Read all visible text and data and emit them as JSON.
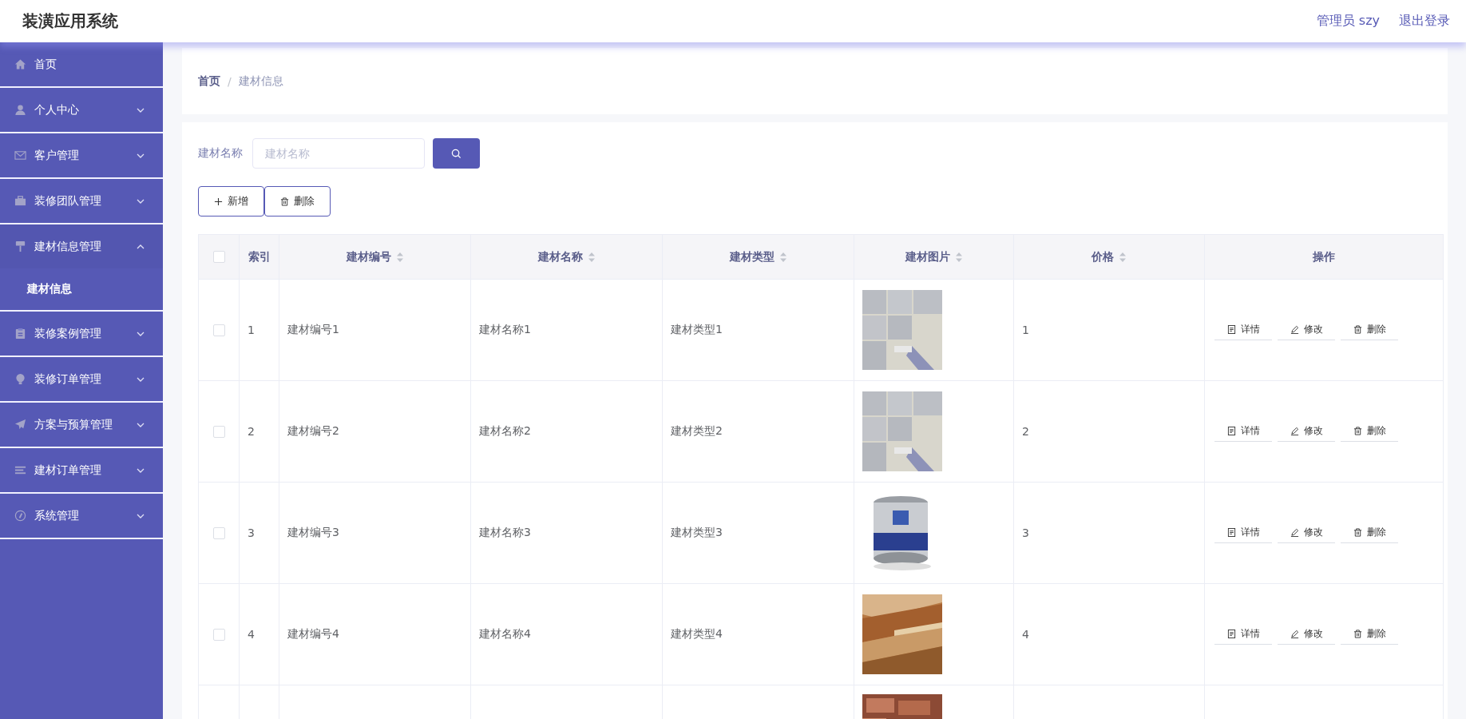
{
  "app_title": "装潢应用系统",
  "header_links": [
    {
      "label": "管理员 szy"
    },
    {
      "label": "退出登录"
    }
  ],
  "sidebar": {
    "items": [
      {
        "label": "首页",
        "kind": "link"
      },
      {
        "label": "个人中心",
        "kind": "submenu",
        "expanded": false
      },
      {
        "label": "客户管理",
        "kind": "submenu",
        "expanded": false
      },
      {
        "label": "装修团队管理",
        "kind": "submenu",
        "expanded": false
      },
      {
        "label": "建材信息管理",
        "kind": "submenu",
        "expanded": true,
        "children": [
          {
            "label": "建材信息",
            "selected": true
          }
        ]
      },
      {
        "label": "装修案例管理",
        "kind": "submenu",
        "expanded": false
      },
      {
        "label": "装修订单管理",
        "kind": "submenu",
        "expanded": false
      },
      {
        "label": "方案与预算管理",
        "kind": "submenu",
        "expanded": false
      },
      {
        "label": "建材订单管理",
        "kind": "submenu",
        "expanded": false
      },
      {
        "label": "系统管理",
        "kind": "submenu",
        "expanded": false
      }
    ]
  },
  "breadcrumb": [
    {
      "label": "首页"
    },
    {
      "separator": "/",
      "label": "建材信息"
    }
  ],
  "search": {
    "label": "建材名称",
    "placeholder": "建材名称"
  },
  "toolbar": [
    {
      "label": "新增",
      "kind": "add"
    },
    {
      "label": "删除",
      "kind": "delete"
    }
  ],
  "table": {
    "all_checked": false,
    "columns": [
      {
        "label": "索引",
        "sortable": false
      },
      {
        "label": "建材编号",
        "sortable": true
      },
      {
        "label": "建材名称",
        "sortable": true
      },
      {
        "label": "建材类型",
        "sortable": true
      },
      {
        "label": "建材图片",
        "sortable": true
      },
      {
        "label": "价格",
        "sortable": true
      },
      {
        "label": "操作",
        "sortable": false
      }
    ],
    "rows": [
      {
        "checked": false,
        "index": "1",
        "code": "建材编号1",
        "name": "建材名称1",
        "type": "建材类型1",
        "image": {
          "kind": "picture"
        },
        "price": "1",
        "actions": [
          {
            "label": "详情",
            "kind": "detail"
          },
          {
            "label": "修改",
            "kind": "edit"
          },
          {
            "label": "删除",
            "kind": "delete"
          }
        ]
      },
      {
        "checked": false,
        "index": "2",
        "code": "建材编号2",
        "name": "建材名称2",
        "type": "建材类型2",
        "image": {
          "kind": "picture"
        },
        "price": "2",
        "actions": [
          {
            "label": "详情",
            "kind": "detail"
          },
          {
            "label": "修改",
            "kind": "edit"
          },
          {
            "label": "删除",
            "kind": "delete"
          }
        ]
      },
      {
        "checked": false,
        "index": "3",
        "code": "建材编号3",
        "name": "建材名称3",
        "type": "建材类型3",
        "image": {
          "kind": "picture"
        },
        "price": "3",
        "actions": [
          {
            "label": "详情",
            "kind": "detail"
          },
          {
            "label": "修改",
            "kind": "edit"
          },
          {
            "label": "删除",
            "kind": "delete"
          }
        ]
      },
      {
        "checked": false,
        "index": "4",
        "code": "建材编号4",
        "name": "建材名称4",
        "type": "建材类型4",
        "image": {
          "kind": "picture"
        },
        "price": "4",
        "actions": [
          {
            "label": "详情",
            "kind": "detail"
          },
          {
            "label": "修改",
            "kind": "edit"
          },
          {
            "label": "删除",
            "kind": "delete"
          }
        ]
      },
      {
        "image": {
          "kind": "picture"
        }
      }
    ]
  }
}
